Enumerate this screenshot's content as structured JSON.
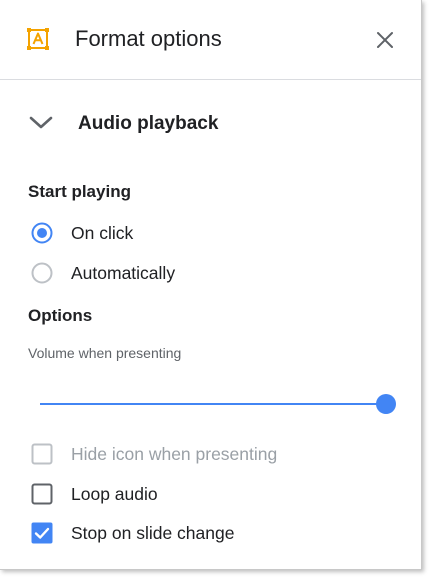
{
  "header": {
    "title": "Format options",
    "icon": "format-options-icon",
    "close_icon": "close-icon",
    "accent_color": "#f4a300"
  },
  "section": {
    "title": "Audio playback",
    "expanded": true,
    "icon": "chevron-down-icon"
  },
  "start_playing": {
    "label": "Start playing",
    "options": [
      {
        "label": "On click",
        "selected": true
      },
      {
        "label": "Automatically",
        "selected": false
      }
    ]
  },
  "options": {
    "label": "Options",
    "volume_label": "Volume when presenting",
    "volume_level": 1.0,
    "checkboxes": [
      {
        "label": "Hide icon when presenting",
        "checked": false,
        "disabled": true
      },
      {
        "label": "Loop audio",
        "checked": false,
        "disabled": false
      },
      {
        "label": "Stop on slide change",
        "checked": true,
        "disabled": false
      }
    ]
  },
  "colors": {
    "primary": "#4285f4",
    "unchecked_border": "#5f6368",
    "disabled": "#bdc1c6"
  }
}
